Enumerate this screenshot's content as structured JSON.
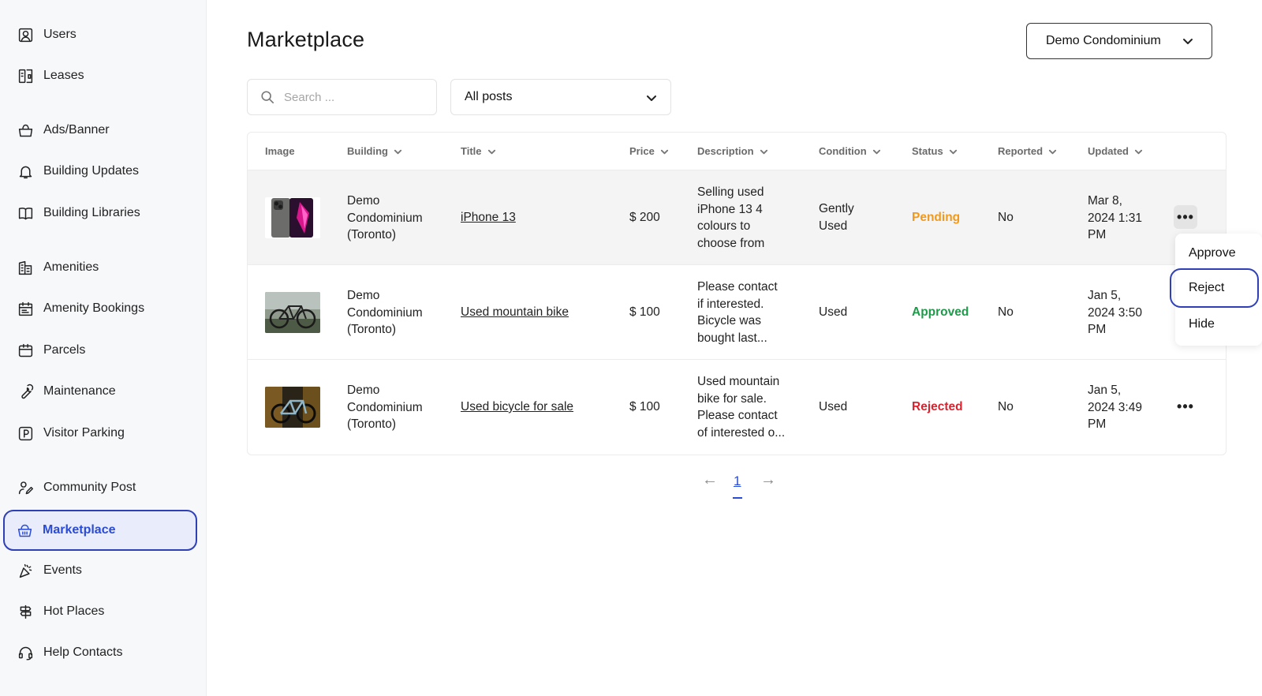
{
  "sidebar": {
    "items": [
      {
        "label": "Users",
        "icon": "user-icon"
      },
      {
        "label": "Leases",
        "icon": "lease-icon"
      },
      {
        "label": "Ads/Banner",
        "icon": "shopping-bag-icon"
      },
      {
        "label": "Building Updates",
        "icon": "bell-icon"
      },
      {
        "label": "Building Libraries",
        "icon": "book-icon"
      },
      {
        "label": "Amenities",
        "icon": "building-icon"
      },
      {
        "label": "Amenity Bookings",
        "icon": "calendar-icon"
      },
      {
        "label": "Parcels",
        "icon": "parcel-icon"
      },
      {
        "label": "Maintenance",
        "icon": "wrench-icon"
      },
      {
        "label": "Visitor Parking",
        "icon": "parking-icon"
      },
      {
        "label": "Community Post",
        "icon": "community-icon"
      },
      {
        "label": "Marketplace",
        "icon": "basket-icon",
        "active": true
      },
      {
        "label": "Events",
        "icon": "party-icon"
      },
      {
        "label": "Hot Places",
        "icon": "signpost-icon"
      },
      {
        "label": "Help Contacts",
        "icon": "headset-icon"
      }
    ]
  },
  "header": {
    "title": "Marketplace",
    "building_select": "Demo Condominium"
  },
  "filters": {
    "search_placeholder": "Search ...",
    "search_value": "",
    "post_filter": "All posts"
  },
  "table": {
    "columns": [
      "Image",
      "Building",
      "Title",
      "Price",
      "Description",
      "Condition",
      "Status",
      "Reported",
      "Updated"
    ],
    "rows": [
      {
        "image": "iphone-photo",
        "building": [
          "Demo",
          "Condominium",
          "(Toronto)"
        ],
        "title": "iPhone 13",
        "price": "$ 200",
        "description": [
          "Selling used",
          "iPhone 13 4",
          "colours to",
          "choose from"
        ],
        "condition": [
          "Gently",
          "Used"
        ],
        "status": "Pending",
        "reported": "No",
        "updated": [
          "Mar 8,",
          "2024 1:31",
          "PM"
        ]
      },
      {
        "image": "bike-photo",
        "building": [
          "Demo",
          "Condominium",
          "(Toronto)"
        ],
        "title": "Used mountain bike",
        "price": "$ 100",
        "description": [
          "Please contact",
          "if interested.",
          "Bicycle was",
          "bought last..."
        ],
        "condition": [
          "Used"
        ],
        "status": "Approved",
        "reported": "No",
        "updated": [
          "Jan 5,",
          "2024 3:50",
          "PM"
        ]
      },
      {
        "image": "bicycle-photo",
        "building": [
          "Demo",
          "Condominium",
          "(Toronto)"
        ],
        "title": "Used bicycle for sale",
        "price": "$ 100",
        "description": [
          "Used mountain",
          "bike for sale.",
          "Please contact",
          "of interested o..."
        ],
        "condition": [
          "Used"
        ],
        "status": "Rejected",
        "reported": "No",
        "updated": [
          "Jan 5,",
          "2024 3:49",
          "PM"
        ]
      }
    ]
  },
  "action_menu": {
    "items": [
      "Approve",
      "Reject",
      "Hide"
    ],
    "more_glyph": "•••"
  },
  "pagination": {
    "prev": "←",
    "current": "1",
    "next": "→"
  },
  "colors": {
    "accent": "#2a4bd6",
    "pending": "#f2991c",
    "approved": "#1e9a4a",
    "rejected": "#d8242f"
  }
}
